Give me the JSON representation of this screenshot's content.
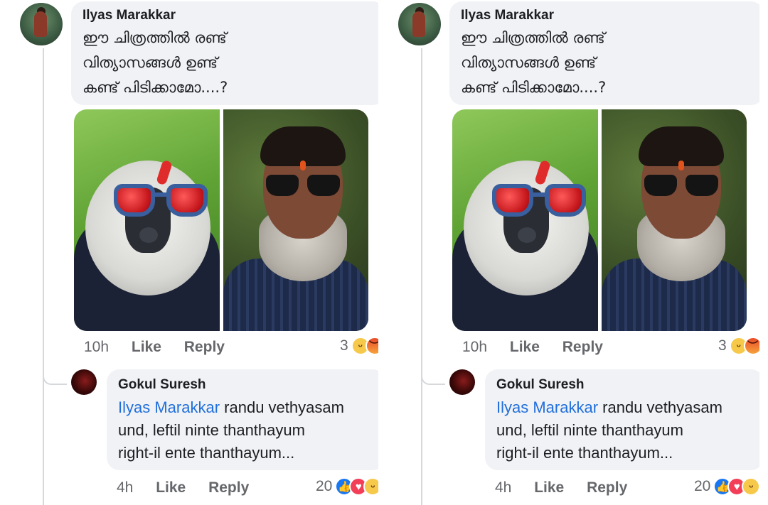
{
  "comment": {
    "author": "Ilyas Marakkar",
    "text_lines": [
      "ഈ ചിത്രത്തിൽ രണ്ട്",
      "വിത്യാസങ്ങൾ ഉണ്ട്",
      "കണ്ട് പിടിക്കാമോ....?"
    ],
    "meta": {
      "time": "10h",
      "like": "Like",
      "reply": "Reply"
    },
    "reactions": {
      "count": "3",
      "icons": [
        "haha-icon",
        "angry-icon"
      ]
    }
  },
  "reply": {
    "author": "Gokul Suresh",
    "mention": "Ilyas Marakkar",
    "text_line1_rest": " randu vethyasam",
    "text_line2": "und, leftil ninte thanthayum",
    "text_line3": "right-il ente thanthayum...",
    "meta": {
      "time": "4h",
      "like": "Like",
      "reply": "Reply"
    },
    "reactions": {
      "count": "20",
      "icons": [
        "like-icon",
        "love-icon",
        "haha-icon"
      ]
    }
  },
  "colors": {
    "bubble": "#f0f2f5",
    "mention": "#216fdb",
    "meta_text": "#65676b",
    "like_blue": "#1877f2"
  }
}
